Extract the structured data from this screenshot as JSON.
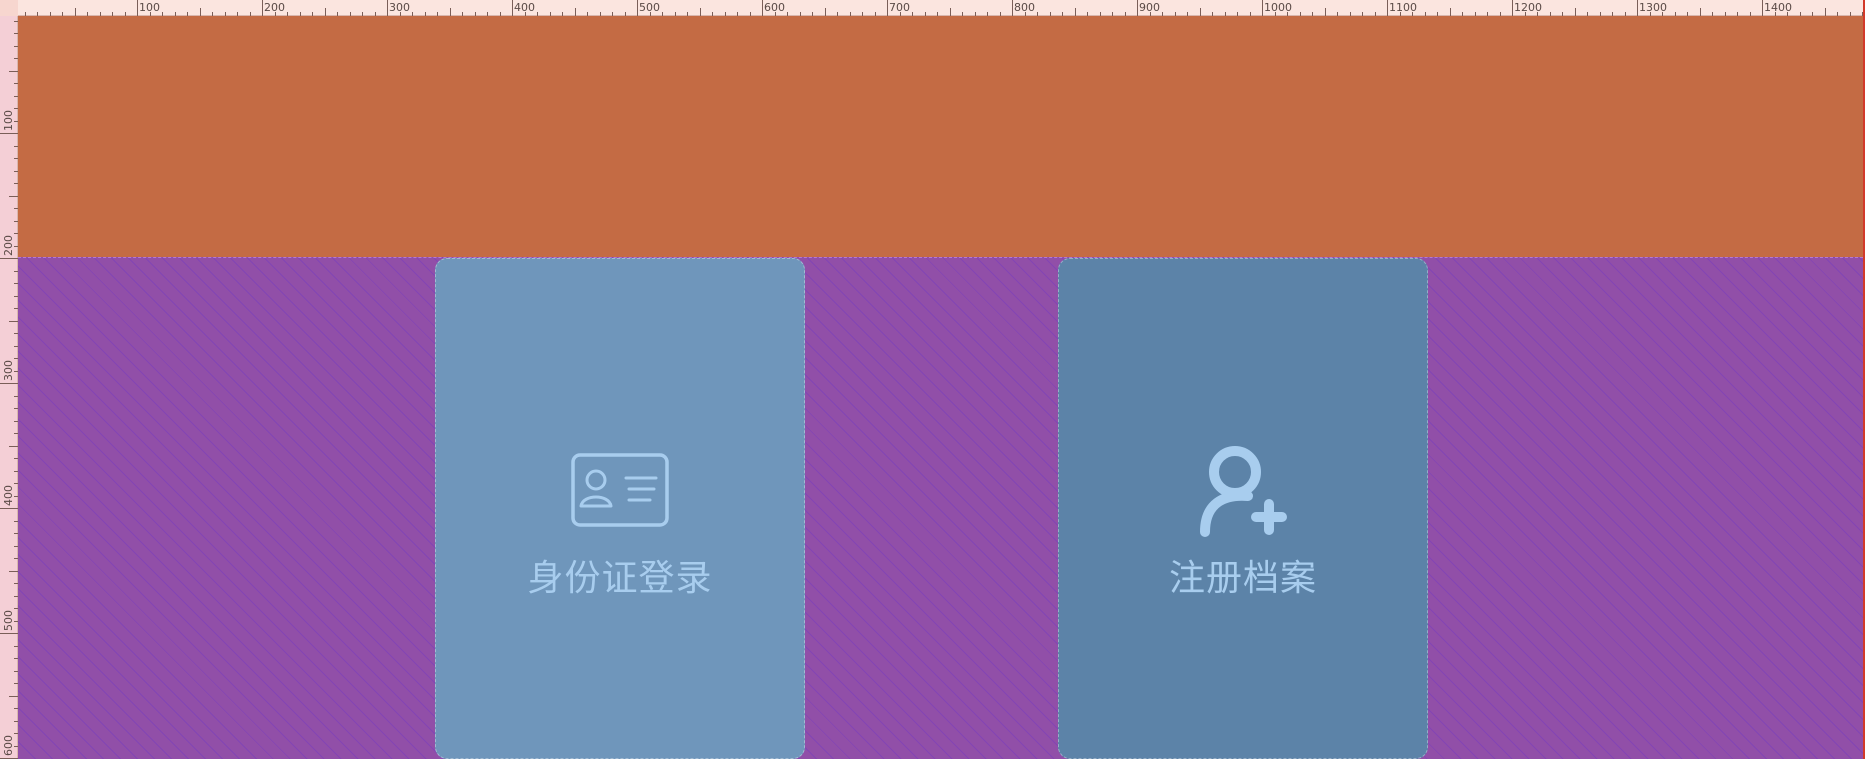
{
  "ruler": {
    "top_labels": [
      "100",
      "200",
      "300",
      "400",
      "500",
      "600",
      "700",
      "800",
      "900",
      "1000",
      "1100",
      "1200",
      "1300",
      "1400"
    ],
    "left_labels": [
      "100",
      "200",
      "300",
      "400",
      "500",
      "600"
    ]
  },
  "cards": {
    "id_login": {
      "label": "身份证登录",
      "icon": "id-card-icon"
    },
    "register": {
      "label": "注册档案",
      "icon": "user-add-icon"
    }
  },
  "colors": {
    "header": "#c46b44",
    "body": "#914fa8",
    "card_id": "#6f96bb",
    "card_register": "#5c83a8",
    "accent_text": "#a8cdee"
  }
}
